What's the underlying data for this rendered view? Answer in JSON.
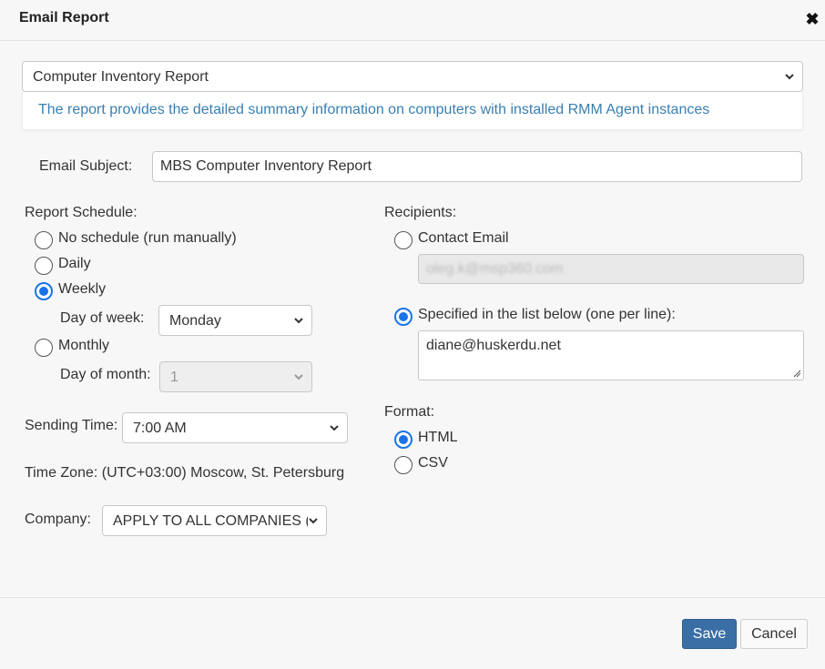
{
  "dialog": {
    "title": "Email Report"
  },
  "report": {
    "selected": "Computer Inventory Report",
    "description": "The report provides the detailed summary information on computers with installed RMM Agent instances"
  },
  "subject": {
    "label": "Email Subject:",
    "value": "MBS Computer Inventory Report"
  },
  "schedule": {
    "label": "Report Schedule:",
    "options": [
      "No schedule (run manually)",
      "Daily",
      "Weekly",
      "Monthly"
    ],
    "selected": "Weekly",
    "day_of_week_label": "Day of week:",
    "day_of_week_value": "Monday",
    "day_of_month_label": "Day of month:",
    "day_of_month_value": "1"
  },
  "sending_time": {
    "label": "Sending Time:",
    "value": "7:00 AM"
  },
  "timezone": {
    "text": "Time Zone: (UTC+03:00) Moscow, St. Petersburg"
  },
  "company": {
    "label": "Company:",
    "value": "APPLY TO ALL COMPANIES ("
  },
  "recipients": {
    "label": "Recipients:",
    "contact_email_label": "Contact Email",
    "contact_email_value": "oleg.k@msp360.com",
    "list_label": "Specified in the list below (one per line):",
    "list_value": "diane@huskerdu.net",
    "selected": "list"
  },
  "format": {
    "label": "Format:",
    "options": [
      "HTML",
      "CSV"
    ],
    "selected": "HTML"
  },
  "footer": {
    "save_label": "Save",
    "cancel_label": "Cancel"
  },
  "colors": {
    "accent": "#1a73e8",
    "link": "#3a7fb0",
    "save_button": "#3a6fa6"
  }
}
